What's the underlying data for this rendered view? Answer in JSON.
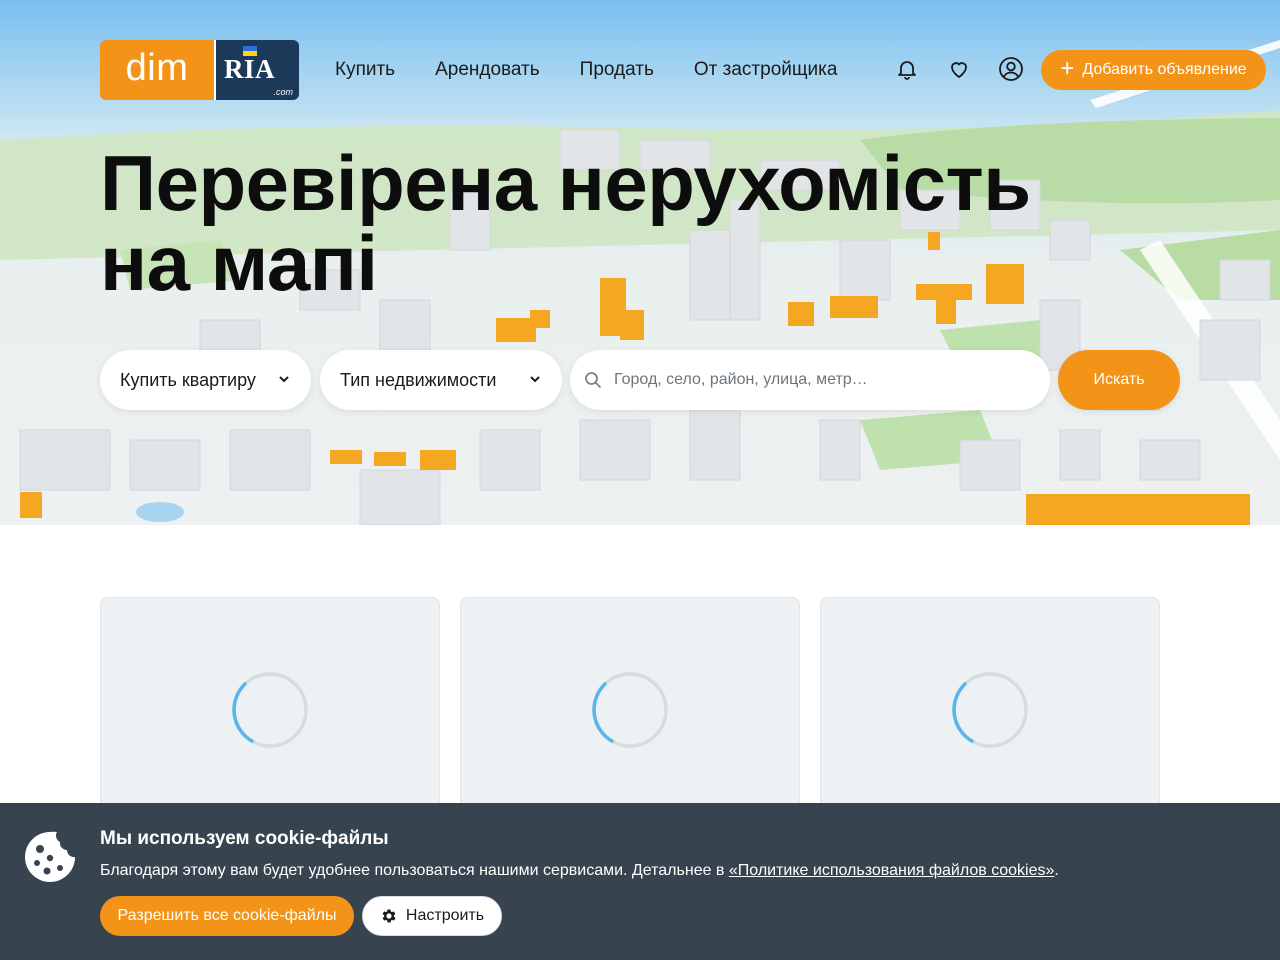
{
  "logo": {
    "left": "dim",
    "right": "RIA",
    "suffix": ".com"
  },
  "nav": {
    "items": [
      "Купить",
      "Арендовать",
      "Продать",
      "От застройщика"
    ]
  },
  "header": {
    "icons": [
      "bell-icon",
      "heart-icon",
      "user-icon"
    ],
    "add_button": "Добавить объявление"
  },
  "hero": {
    "title": "Перевірена нерухомість на мапі"
  },
  "search": {
    "deal_type": "Купить квартиру",
    "property_type": "Тип недвижимости",
    "placeholder": "Город, село, район, улица, метр…",
    "button": "Искать"
  },
  "cards": [
    {
      "state": "loading"
    },
    {
      "state": "loading"
    },
    {
      "state": "loading"
    }
  ],
  "cookie_banner": {
    "title": "Мы используем cookie-файлы",
    "text_before": "Благодаря этому вам будет удобнее пользоваться нашими сервисами. Детальнее в ",
    "link": "«Политике использования файлов cookies»",
    "text_after": ".",
    "allow_button": "Разрешить все cookie-файлы",
    "settings_button": "Настроить"
  },
  "colors": {
    "accent": "#f39419",
    "logo_dark": "#1b3a5a",
    "banner_bg": "#37444f",
    "card_bg": "#eef1f3"
  }
}
